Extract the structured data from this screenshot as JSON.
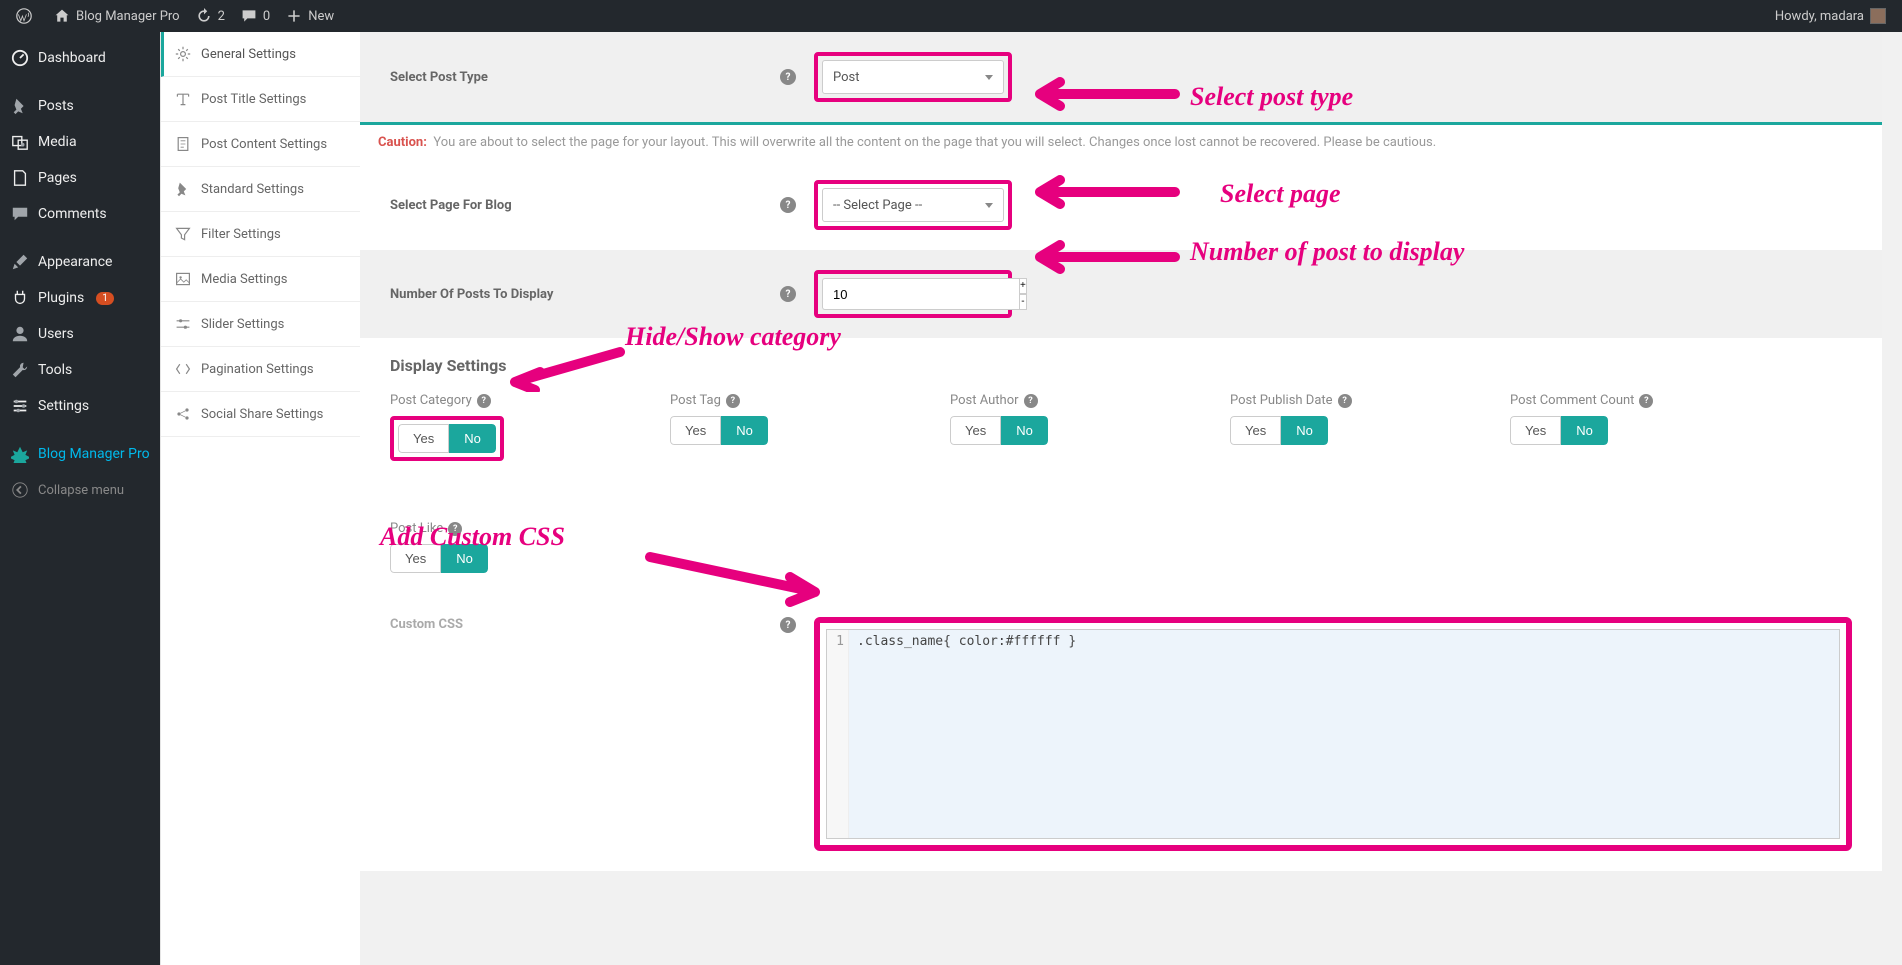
{
  "adminBar": {
    "siteTitle": "Blog Manager Pro",
    "updates": "2",
    "comments": "0",
    "new": "New",
    "greeting": "Howdy, madara"
  },
  "wpMenu": [
    {
      "id": "dashboard",
      "label": "Dashboard",
      "icon": "dash"
    },
    {
      "id": "posts",
      "label": "Posts",
      "icon": "pin"
    },
    {
      "id": "media",
      "label": "Media",
      "icon": "media"
    },
    {
      "id": "pages",
      "label": "Pages",
      "icon": "page"
    },
    {
      "id": "comments",
      "label": "Comments",
      "icon": "comment"
    },
    {
      "id": "appearance",
      "label": "Appearance",
      "icon": "brush"
    },
    {
      "id": "plugins",
      "label": "Plugins",
      "icon": "plug",
      "badge": "1"
    },
    {
      "id": "users",
      "label": "Users",
      "icon": "user"
    },
    {
      "id": "tools",
      "label": "Tools",
      "icon": "wrench"
    },
    {
      "id": "settings",
      "label": "Settings",
      "icon": "sliders"
    },
    {
      "id": "blogmanager",
      "label": "Blog Manager Pro",
      "icon": "plugin",
      "active": true
    },
    {
      "id": "collapse",
      "label": "Collapse menu",
      "icon": "collapse",
      "collapse": true
    }
  ],
  "tabs": [
    {
      "id": "general",
      "label": "General Settings",
      "icon": "gear",
      "active": true
    },
    {
      "id": "title",
      "label": "Post Title Settings",
      "icon": "title"
    },
    {
      "id": "content",
      "label": "Post Content Settings",
      "icon": "doc"
    },
    {
      "id": "standard",
      "label": "Standard Settings",
      "icon": "pin"
    },
    {
      "id": "filter",
      "label": "Filter Settings",
      "icon": "filter"
    },
    {
      "id": "media_s",
      "label": "Media Settings",
      "icon": "image"
    },
    {
      "id": "slider",
      "label": "Slider Settings",
      "icon": "slider"
    },
    {
      "id": "pagination",
      "label": "Pagination Settings",
      "icon": "pagi"
    },
    {
      "id": "social",
      "label": "Social Share Settings",
      "icon": "share"
    }
  ],
  "form": {
    "postType": {
      "label": "Select Post Type",
      "value": "Post"
    },
    "caution": {
      "label": "Caution:",
      "text": "You are about to select the page for your layout. This will overwrite all the content on the page that you will select. Changes once lost cannot be recovered. Please be cautious."
    },
    "selectPage": {
      "label": "Select Page For Blog",
      "value": "-- Select Page --"
    },
    "numPosts": {
      "label": "Number Of Posts To Display",
      "value": "10"
    },
    "displayHeader": "Display Settings",
    "display": [
      {
        "label": "Post Category",
        "value": "No",
        "highlight": true
      },
      {
        "label": "Post Tag",
        "value": "No"
      },
      {
        "label": "Post Author",
        "value": "No"
      },
      {
        "label": "Post Publish Date",
        "value": "No"
      },
      {
        "label": "Post Comment Count",
        "value": "No"
      },
      {
        "label": "Post Like",
        "value": "No"
      }
    ],
    "yes": "Yes",
    "no": "No",
    "customCss": {
      "label": "Custom CSS",
      "code": ".class_name{ color:#ffffff }",
      "line": "1"
    }
  },
  "annotations": {
    "postType": "Select post type",
    "selectPage": "Select page",
    "numPosts": "Number of post to display",
    "category": "Hide/Show category",
    "css": "Add Custom CSS"
  }
}
